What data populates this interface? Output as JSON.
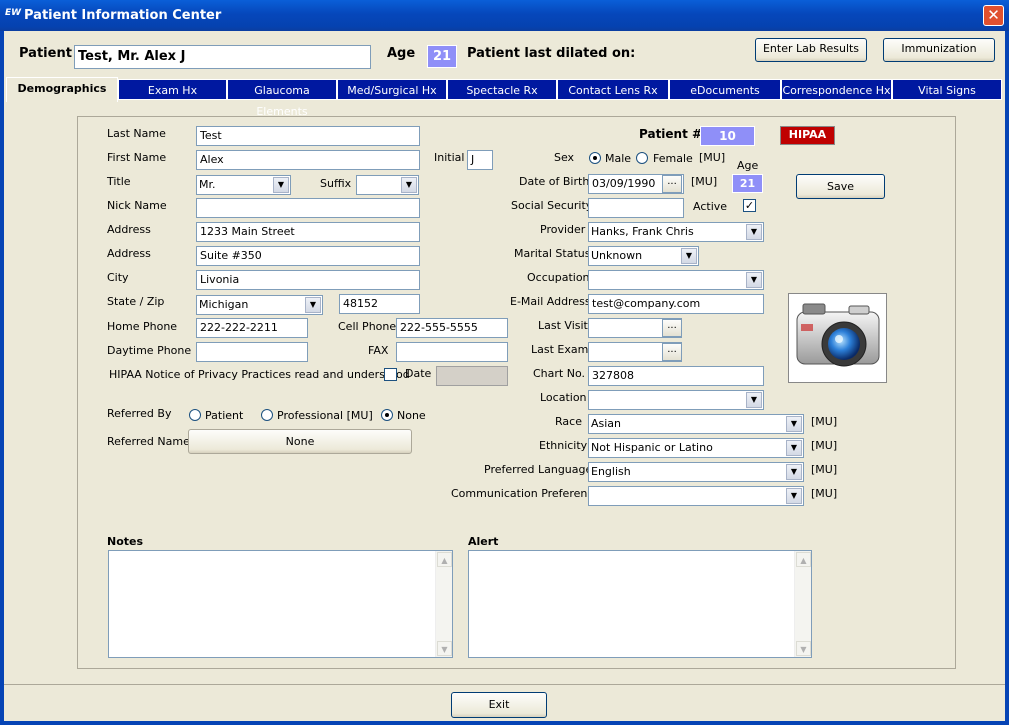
{
  "window": {
    "logo": "EW",
    "title": "Patient Information Center",
    "close_glyph": "✕"
  },
  "header": {
    "patient_label": "Patient",
    "patient_name": "Test, Mr. Alex J",
    "age_label": "Age",
    "age_value": "21",
    "dilated_label": "Patient last dilated on:",
    "lab_button": "Enter Lab Results",
    "immunization_button": "Immunization"
  },
  "tabs": [
    "Demographics",
    "Exam Hx",
    "Glaucoma Elements",
    "Med/Surgical Hx",
    "Spectacle Rx",
    "Contact Lens Rx",
    "eDocuments",
    "Correspondence Hx",
    "Vital Signs"
  ],
  "form": {
    "last_name_label": "Last Name",
    "last_name": "Test",
    "first_name_label": "First Name",
    "first_name": "Alex",
    "initial_label": "Initial",
    "initial": "J",
    "title_label": "Title",
    "title": "Mr.",
    "suffix_label": "Suffix",
    "suffix": "",
    "nick_label": "Nick Name",
    "nick": "",
    "address_label": "Address",
    "address1": "1233 Main Street",
    "address2_label": "Address",
    "address2": "Suite #350",
    "city_label": "City",
    "city": "Livonia",
    "state_zip_label": "State / Zip",
    "state": "Michigan",
    "zip": "48152",
    "home_phone_label": "Home Phone",
    "home_phone": "222-222-2211",
    "cell_phone_label": "Cell Phone",
    "cell_phone": "222-555-5555",
    "day_phone_label": "Daytime Phone",
    "day_phone": "",
    "fax_label": "FAX",
    "fax": "",
    "hipaa_notice_label": "HIPAA Notice of Privacy Practices read and understood",
    "hipaa_date_label": "Date",
    "referred_by_label": "Referred By",
    "referred_options": [
      "Patient",
      "Professional [MU]",
      "None"
    ],
    "referred_selected": "None",
    "referred_name_label": "Referred Name",
    "referred_name": "None",
    "patient_num_label": "Patient #",
    "patient_num": "10",
    "hipaa_button": "HIPAA",
    "sex_label": "Sex",
    "sex_options": [
      "Male",
      "Female"
    ],
    "sex_selected": "Male",
    "sex_mu": "[MU]",
    "dob_label": "Date of Birth",
    "dob": "03/09/1990",
    "dob_mu": "[MU]",
    "age_small_label": "Age",
    "age_small": "21",
    "save_button": "Save",
    "ssn_label": "Social Security",
    "ssn": "",
    "active_label": "Active",
    "active": true,
    "provider_label": "Provider",
    "provider": "Hanks, Frank Chris",
    "marital_label": "Marital Status",
    "marital": "Unknown",
    "occupation_label": "Occupation",
    "occupation": "",
    "email_label": "E-Mail Address",
    "email": "test@company.com",
    "last_visit_label": "Last Visit",
    "last_visit": "",
    "last_exam_label": "Last Exam",
    "last_exam": "",
    "chart_label": "Chart No.",
    "chart": "327808",
    "location_label": "Location",
    "location": "",
    "race_label": "Race",
    "race": "Asian",
    "race_mu": "[MU]",
    "ethnicity_label": "Ethnicity",
    "ethnicity": "Not Hispanic or Latino",
    "ethnicity_mu": "[MU]",
    "language_label": "Preferred Language",
    "language": "English",
    "language_mu": "[MU]",
    "comm_label": "Communication Preference",
    "comm": "",
    "comm_mu": "[MU]",
    "notes_label": "Notes",
    "alert_label": "Alert",
    "ellipsis": "..."
  },
  "footer": {
    "exit_button": "Exit"
  },
  "icons": {
    "dropdown": "▼",
    "check": "✓",
    "scroll_up": "▲",
    "scroll_down": "▼"
  }
}
